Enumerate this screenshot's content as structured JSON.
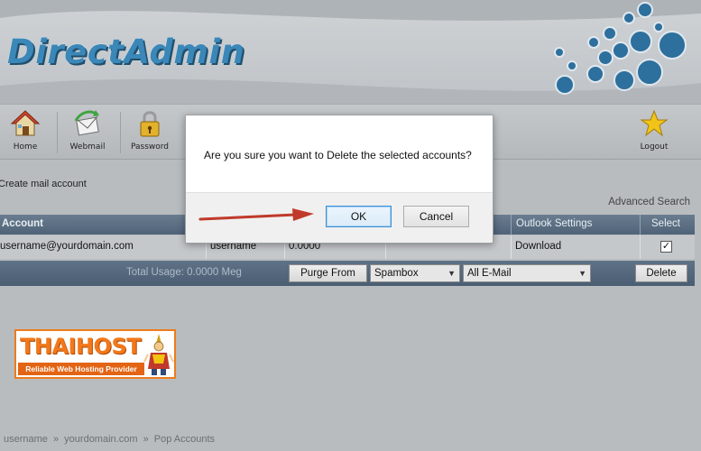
{
  "header": {
    "logo_text": "DirectAdmin"
  },
  "toolbar": {
    "items": [
      {
        "label": "Home",
        "icon": "house-icon"
      },
      {
        "label": "Webmail",
        "icon": "webmail-icon"
      },
      {
        "label": "Password",
        "icon": "padlock-icon"
      },
      {
        "label": "Logout",
        "icon": "star-icon"
      }
    ]
  },
  "content": {
    "create_link": "Create mail account",
    "advanced_search": "Advanced Search"
  },
  "table": {
    "headers": [
      "Account",
      "Outlook Settings",
      "Select"
    ],
    "rows": [
      {
        "account": "username@yourdomain.com",
        "user": "username",
        "usage": "0.0000",
        "outlook": "Download",
        "selected": "✓"
      }
    ]
  },
  "footer": {
    "total_usage": "Total Usage: 0.0000 Meg",
    "purge_button": "Purge From",
    "folder_select": "Spambox",
    "filter_select": "All E-Mail",
    "delete_button": "Delete"
  },
  "sponsor": {
    "name": "THAIHOST",
    "tagline": "Reliable Web Hosting Provider"
  },
  "breadcrumb": {
    "items": [
      "username",
      "»",
      "yourdomain.com",
      "»",
      "Pop Accounts"
    ]
  },
  "dialog": {
    "message": "Are you sure you want to Delete the selected accounts?",
    "ok_label": "OK",
    "cancel_label": "Cancel"
  },
  "colors": {
    "brand_blue": "#3a87b8",
    "table_header": "#5a6d82",
    "arrow_red": "#c0392b",
    "thaihost_orange": "#f2781b"
  }
}
